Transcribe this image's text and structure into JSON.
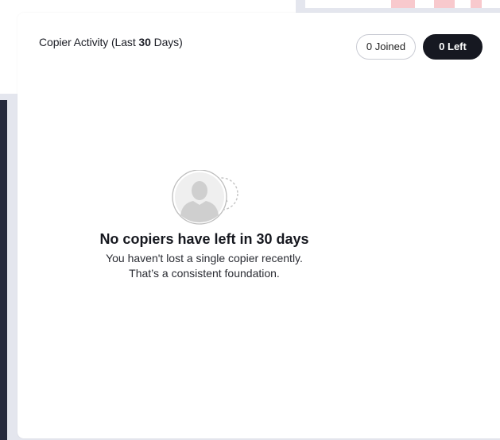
{
  "card": {
    "title_prefix": "Copier Activity (Last ",
    "title_days": "30",
    "title_suffix": " Days)"
  },
  "toggles": {
    "joined_label": "0 Joined",
    "left_label": "0 Left",
    "active": "left"
  },
  "empty_state": {
    "icon": "user-left-icon",
    "title": "No copiers have left in 30 days",
    "line1": "You haven't lost a single copier recently.",
    "line2": "That’s a consistent foundation."
  },
  "colors": {
    "active_toggle": "#161821",
    "background": "#e4e6ee",
    "accent_pink": "#f8c9cd"
  }
}
